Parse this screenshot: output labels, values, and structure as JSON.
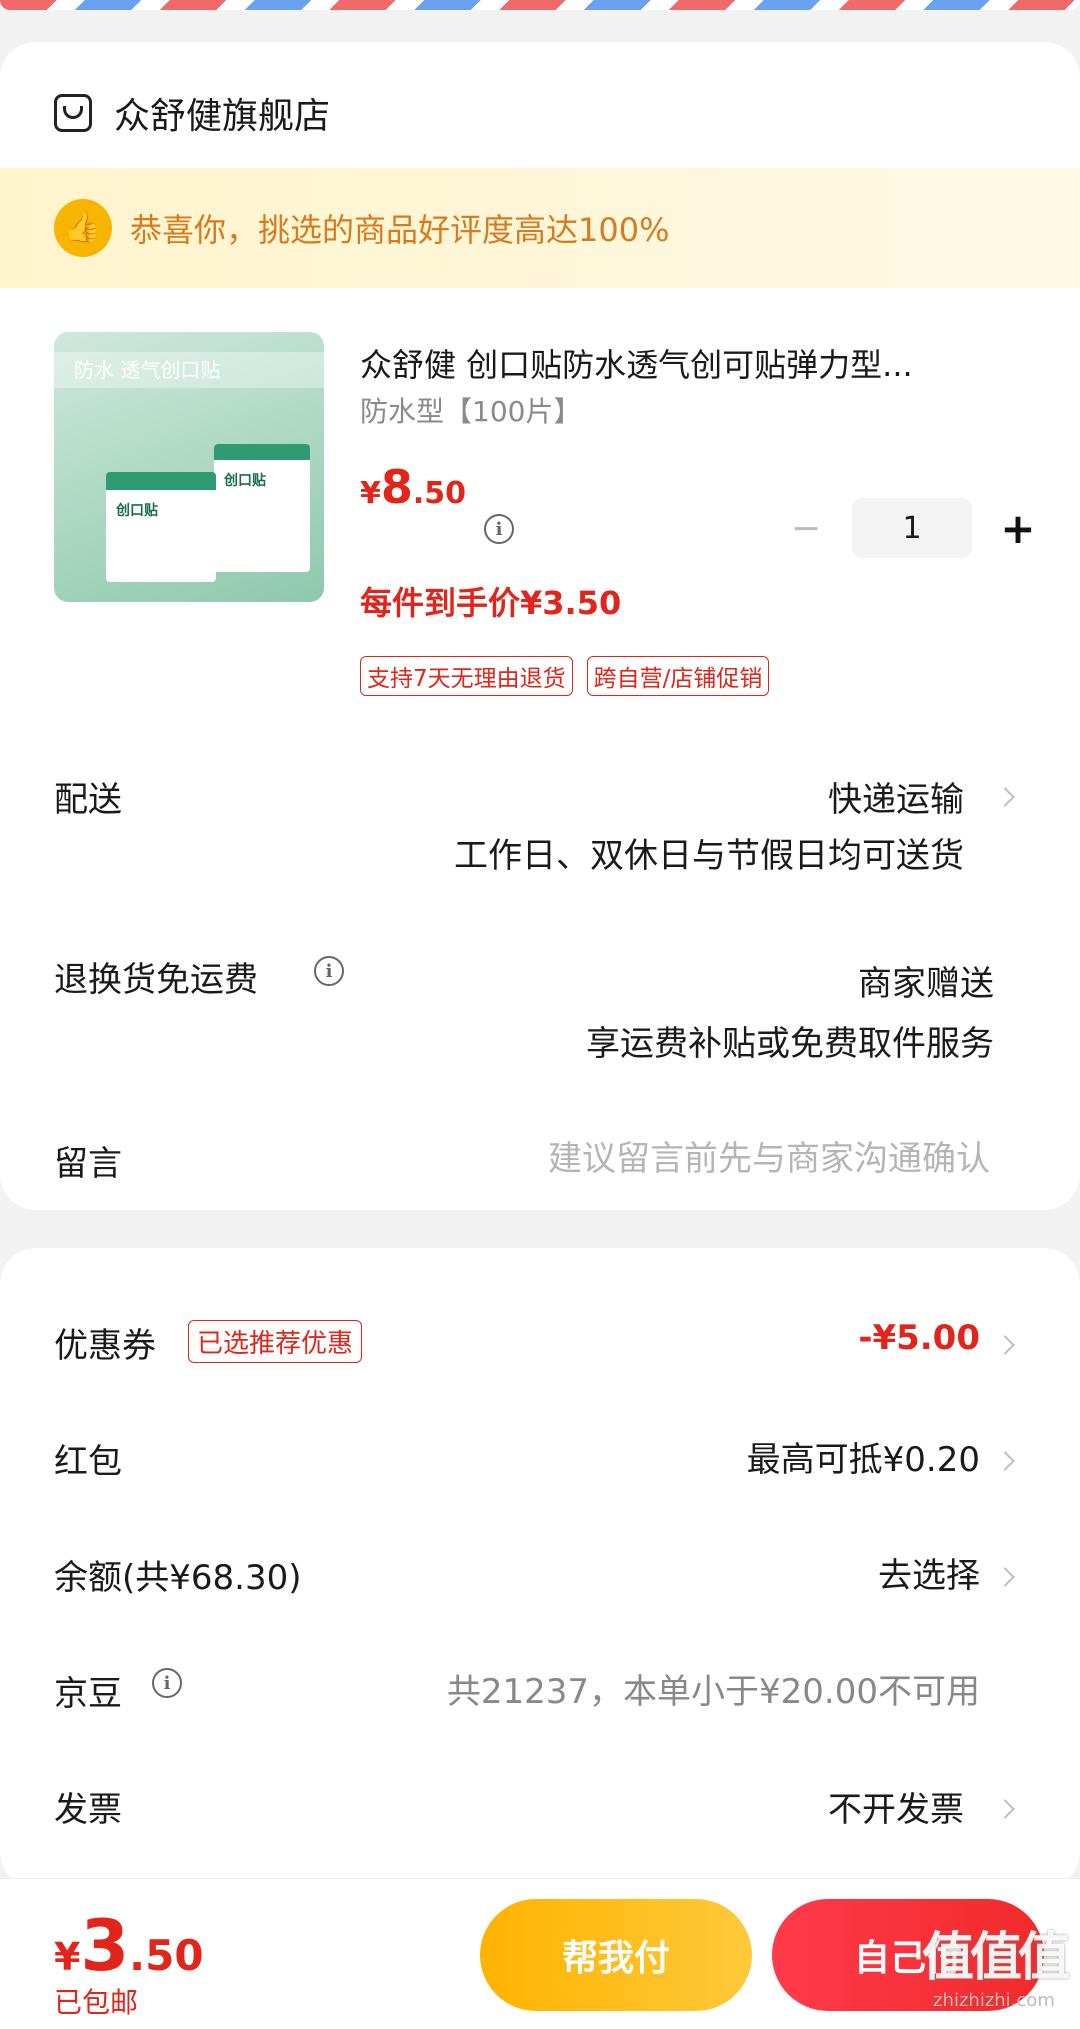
{
  "store": {
    "name": "众舒健旗舰店",
    "icon": "store-icon"
  },
  "banner": {
    "icon": "thumbs-up-icon",
    "text": "恭喜你，挑选的商品好评度高达100%"
  },
  "product": {
    "image_band_text": "防水 透气创口贴",
    "image_box_text": "创口贴",
    "title": "众舒健 创口贴防水透气创可贴弹力型...",
    "spec": "防水型【100片】",
    "price_currency": "¥",
    "price_int": "8",
    "price_dec": ".50",
    "quantity": "1",
    "minus": "−",
    "plus": "+",
    "final_price": "每件到手价¥3.50",
    "tags": [
      "支持7天无理由退货",
      "跨自营/店铺促销"
    ]
  },
  "delivery": {
    "label": "配送",
    "method": "快递运输",
    "note": "工作日、双休日与节假日均可送货"
  },
  "return_shipping": {
    "label": "退换货免运费",
    "value": "商家赠送",
    "note": "享运费补贴或免费取件服务"
  },
  "message": {
    "label": "留言",
    "placeholder": "建议留言前先与商家沟通确认"
  },
  "coupon": {
    "label": "优惠券",
    "tag": "已选推荐优惠",
    "value": "-¥5.00"
  },
  "red_packet": {
    "label": "红包",
    "value": "最高可抵¥0.20"
  },
  "balance": {
    "label": "余额(共¥68.30)",
    "value": "去选择"
  },
  "jd_beans": {
    "label": "京豆",
    "value": "共21237，本单小于¥20.00不可用"
  },
  "invoice": {
    "label": "发票",
    "value": "不开发票"
  },
  "footer": {
    "total_currency": "¥",
    "total_int": "3",
    "total_dec": ".50",
    "shipping": "已包邮",
    "help_pay": "帮我付",
    "self_pay": "自己付"
  },
  "watermark": {
    "logo": "值值值",
    "url": "zhizhizhi.com"
  },
  "colors": {
    "accent_red": "#e1251b",
    "accent_orange": "#ffb300",
    "banner_text": "#d67c1e"
  }
}
